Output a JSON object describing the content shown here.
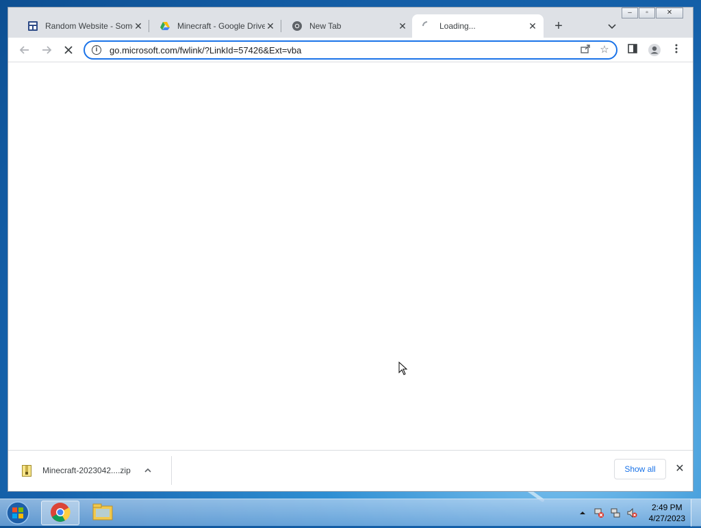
{
  "browser": {
    "tabs": [
      {
        "title": "Random Website - Some",
        "favicon": "website-icon",
        "active": false
      },
      {
        "title": "Minecraft - Google Drive",
        "favicon": "google-drive-icon",
        "active": false
      },
      {
        "title": "New Tab",
        "favicon": "chrome-icon",
        "active": false
      },
      {
        "title": "Loading...",
        "favicon": "loading-spinner-icon",
        "active": true
      }
    ],
    "new_tab_label": "+",
    "window_controls": {
      "minimize": "–",
      "maximize": "▫",
      "close": "✕"
    },
    "address_bar": {
      "url": "go.microsoft.com/fwlink/?LinkId=57426&Ext=vba"
    },
    "toolbar_icons": [
      "back-icon",
      "forward-icon",
      "stop-loading-icon",
      "info-icon",
      "share-icon",
      "bookmark-star-icon",
      "side-panel-icon",
      "profile-icon",
      "menu-icon"
    ]
  },
  "download_bar": {
    "file_name": "Minecraft-2023042....zip",
    "show_all_label": "Show all",
    "close_label": "✕"
  },
  "taskbar": {
    "apps": [
      "start-orb-icon",
      "chrome-icon",
      "file-explorer-icon"
    ],
    "tray_icons": [
      "show-hidden-icons",
      "action-center-flag-icon",
      "network-icon",
      "volume-muted-icon"
    ],
    "clock": {
      "time": "2:49 PM",
      "date": "4/27/2023"
    }
  },
  "colors": {
    "accent": "#1a73e8",
    "tabstrip": "#dee1e6"
  }
}
